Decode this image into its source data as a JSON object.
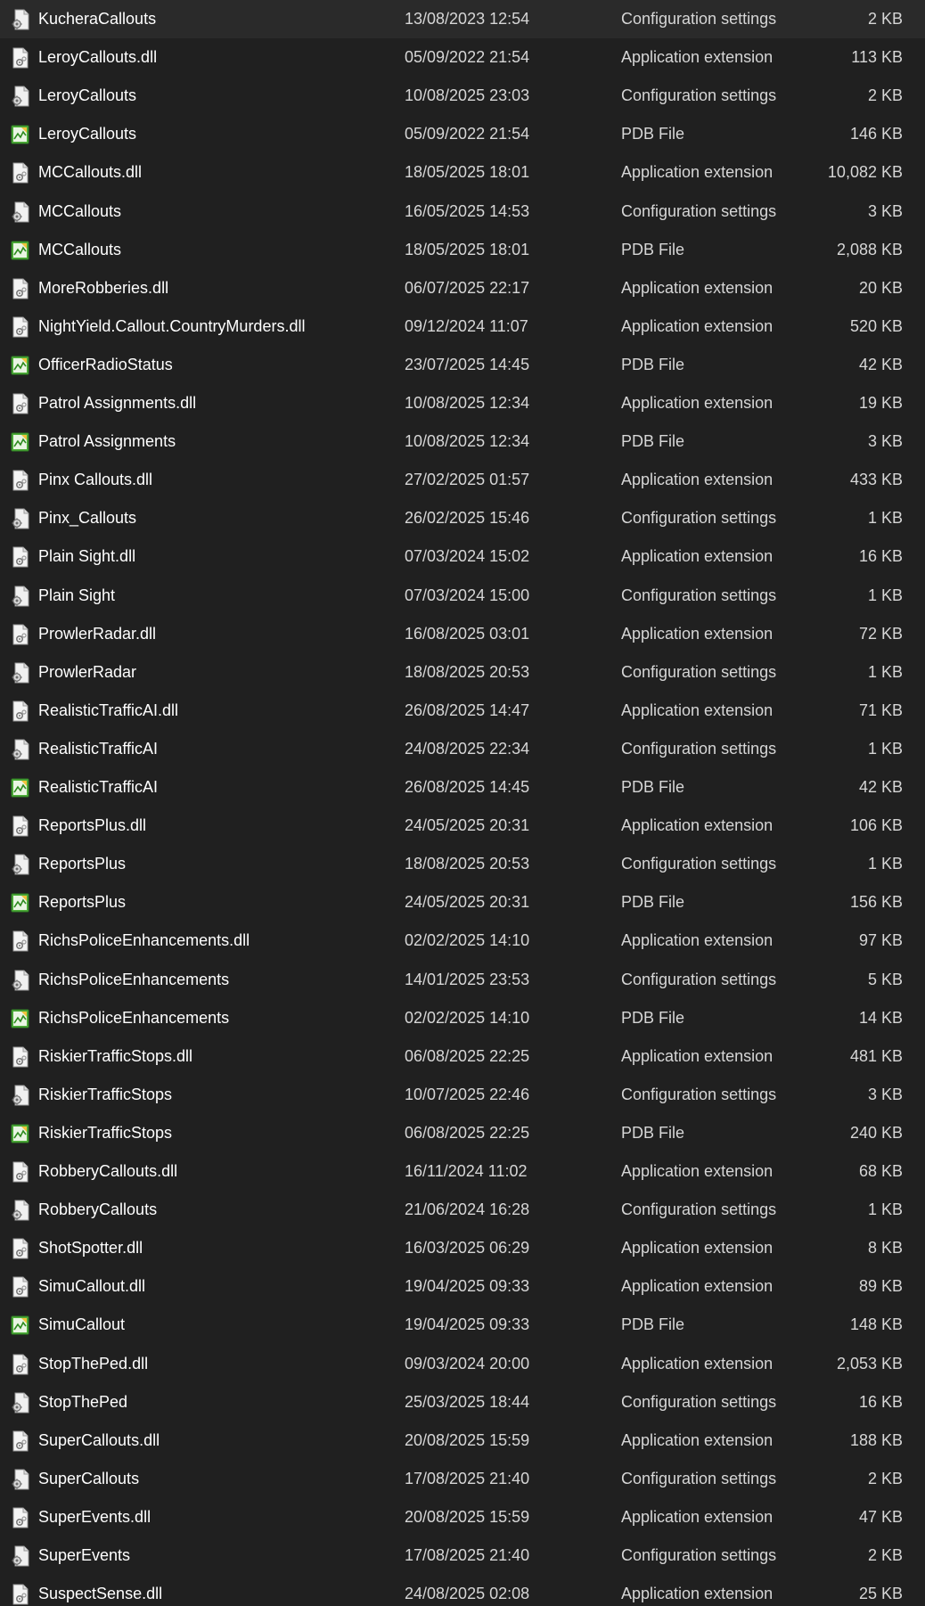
{
  "icons": {
    "dll": "dll-file-icon",
    "config": "config-file-icon",
    "pdb": "pdb-file-icon"
  },
  "colors": {
    "background": "#202020",
    "text": "#ffffff",
    "pdb_icon_accent": "#3c9a2c"
  },
  "files": [
    {
      "name": "KucheraCallouts",
      "date": "13/08/2023 12:54",
      "type": "Configuration settings",
      "size": "2 KB",
      "icon": "config"
    },
    {
      "name": "LeroyCallouts.dll",
      "date": "05/09/2022 21:54",
      "type": "Application extension",
      "size": "113 KB",
      "icon": "dll"
    },
    {
      "name": "LeroyCallouts",
      "date": "10/08/2025 23:03",
      "type": "Configuration settings",
      "size": "2 KB",
      "icon": "config"
    },
    {
      "name": "LeroyCallouts",
      "date": "05/09/2022 21:54",
      "type": "PDB File",
      "size": "146 KB",
      "icon": "pdb"
    },
    {
      "name": "MCCallouts.dll",
      "date": "18/05/2025 18:01",
      "type": "Application extension",
      "size": "10,082 KB",
      "icon": "dll"
    },
    {
      "name": "MCCallouts",
      "date": "16/05/2025 14:53",
      "type": "Configuration settings",
      "size": "3 KB",
      "icon": "config"
    },
    {
      "name": "MCCallouts",
      "date": "18/05/2025 18:01",
      "type": "PDB File",
      "size": "2,088 KB",
      "icon": "pdb"
    },
    {
      "name": "MoreRobberies.dll",
      "date": "06/07/2025 22:17",
      "type": "Application extension",
      "size": "20 KB",
      "icon": "dll"
    },
    {
      "name": "NightYield.Callout.CountryMurders.dll",
      "date": "09/12/2024 11:07",
      "type": "Application extension",
      "size": "520 KB",
      "icon": "dll"
    },
    {
      "name": "OfficerRadioStatus",
      "date": "23/07/2025 14:45",
      "type": "PDB File",
      "size": "42 KB",
      "icon": "pdb"
    },
    {
      "name": "Patrol Assignments.dll",
      "date": "10/08/2025 12:34",
      "type": "Application extension",
      "size": "19 KB",
      "icon": "dll"
    },
    {
      "name": "Patrol Assignments",
      "date": "10/08/2025 12:34",
      "type": "PDB File",
      "size": "3 KB",
      "icon": "pdb"
    },
    {
      "name": "Pinx Callouts.dll",
      "date": "27/02/2025 01:57",
      "type": "Application extension",
      "size": "433 KB",
      "icon": "dll"
    },
    {
      "name": "Pinx_Callouts",
      "date": "26/02/2025 15:46",
      "type": "Configuration settings",
      "size": "1 KB",
      "icon": "config"
    },
    {
      "name": "Plain Sight.dll",
      "date": "07/03/2024 15:02",
      "type": "Application extension",
      "size": "16 KB",
      "icon": "dll"
    },
    {
      "name": "Plain Sight",
      "date": "07/03/2024 15:00",
      "type": "Configuration settings",
      "size": "1 KB",
      "icon": "config"
    },
    {
      "name": "ProwlerRadar.dll",
      "date": "16/08/2025 03:01",
      "type": "Application extension",
      "size": "72 KB",
      "icon": "dll"
    },
    {
      "name": "ProwlerRadar",
      "date": "18/08/2025 20:53",
      "type": "Configuration settings",
      "size": "1 KB",
      "icon": "config"
    },
    {
      "name": "RealisticTrafficAI.dll",
      "date": "26/08/2025 14:47",
      "type": "Application extension",
      "size": "71 KB",
      "icon": "dll"
    },
    {
      "name": "RealisticTrafficAI",
      "date": "24/08/2025 22:34",
      "type": "Configuration settings",
      "size": "1 KB",
      "icon": "config"
    },
    {
      "name": "RealisticTrafficAI",
      "date": "26/08/2025 14:45",
      "type": "PDB File",
      "size": "42 KB",
      "icon": "pdb"
    },
    {
      "name": "ReportsPlus.dll",
      "date": "24/05/2025 20:31",
      "type": "Application extension",
      "size": "106 KB",
      "icon": "dll"
    },
    {
      "name": "ReportsPlus",
      "date": "18/08/2025 20:53",
      "type": "Configuration settings",
      "size": "1 KB",
      "icon": "config"
    },
    {
      "name": "ReportsPlus",
      "date": "24/05/2025 20:31",
      "type": "PDB File",
      "size": "156 KB",
      "icon": "pdb"
    },
    {
      "name": "RichsPoliceEnhancements.dll",
      "date": "02/02/2025 14:10",
      "type": "Application extension",
      "size": "97 KB",
      "icon": "dll"
    },
    {
      "name": "RichsPoliceEnhancements",
      "date": "14/01/2025 23:53",
      "type": "Configuration settings",
      "size": "5 KB",
      "icon": "config"
    },
    {
      "name": "RichsPoliceEnhancements",
      "date": "02/02/2025 14:10",
      "type": "PDB File",
      "size": "14 KB",
      "icon": "pdb"
    },
    {
      "name": "RiskierTrafficStops.dll",
      "date": "06/08/2025 22:25",
      "type": "Application extension",
      "size": "481 KB",
      "icon": "dll"
    },
    {
      "name": "RiskierTrafficStops",
      "date": "10/07/2025 22:46",
      "type": "Configuration settings",
      "size": "3 KB",
      "icon": "config"
    },
    {
      "name": "RiskierTrafficStops",
      "date": "06/08/2025 22:25",
      "type": "PDB File",
      "size": "240 KB",
      "icon": "pdb"
    },
    {
      "name": "RobberyCallouts.dll",
      "date": "16/11/2024 11:02",
      "type": "Application extension",
      "size": "68 KB",
      "icon": "dll"
    },
    {
      "name": "RobberyCallouts",
      "date": "21/06/2024 16:28",
      "type": "Configuration settings",
      "size": "1 KB",
      "icon": "config"
    },
    {
      "name": "ShotSpotter.dll",
      "date": "16/03/2025 06:29",
      "type": "Application extension",
      "size": "8 KB",
      "icon": "dll"
    },
    {
      "name": "SimuCallout.dll",
      "date": "19/04/2025 09:33",
      "type": "Application extension",
      "size": "89 KB",
      "icon": "dll"
    },
    {
      "name": "SimuCallout",
      "date": "19/04/2025 09:33",
      "type": "PDB File",
      "size": "148 KB",
      "icon": "pdb"
    },
    {
      "name": "StopThePed.dll",
      "date": "09/03/2024 20:00",
      "type": "Application extension",
      "size": "2,053 KB",
      "icon": "dll"
    },
    {
      "name": "StopThePed",
      "date": "25/03/2025 18:44",
      "type": "Configuration settings",
      "size": "16 KB",
      "icon": "config"
    },
    {
      "name": "SuperCallouts.dll",
      "date": "20/08/2025 15:59",
      "type": "Application extension",
      "size": "188 KB",
      "icon": "dll"
    },
    {
      "name": "SuperCallouts",
      "date": "17/08/2025 21:40",
      "type": "Configuration settings",
      "size": "2 KB",
      "icon": "config"
    },
    {
      "name": "SuperEvents.dll",
      "date": "20/08/2025 15:59",
      "type": "Application extension",
      "size": "47 KB",
      "icon": "dll"
    },
    {
      "name": "SuperEvents",
      "date": "17/08/2025 21:40",
      "type": "Configuration settings",
      "size": "2 KB",
      "icon": "config"
    },
    {
      "name": "SuspectSense.dll",
      "date": "24/08/2025 02:08",
      "type": "Application extension",
      "size": "25 KB",
      "icon": "dll"
    }
  ]
}
